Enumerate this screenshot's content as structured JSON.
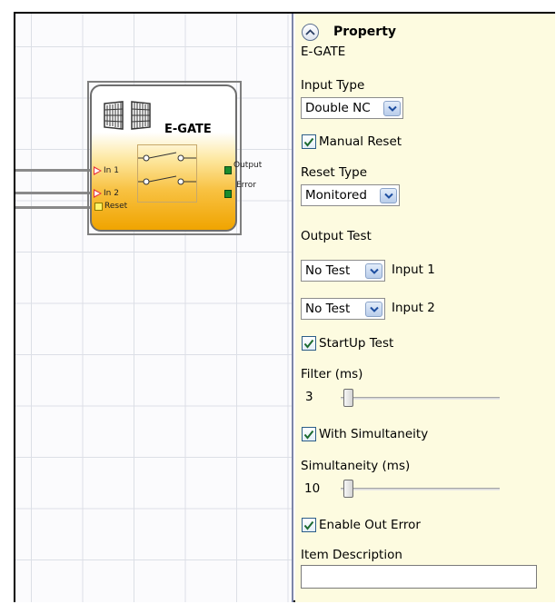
{
  "block": {
    "title": "E-GATE",
    "inputs": [
      "In 1",
      "In 2"
    ],
    "reset_pin": "Reset",
    "outputs": [
      "Output",
      "Error"
    ]
  },
  "property": {
    "header": "Property",
    "component_name": "E-GATE",
    "input_type": {
      "label": "Input Type",
      "value": "Double NC"
    },
    "manual_reset": {
      "label": "Manual Reset",
      "checked": true
    },
    "reset_type": {
      "label": "Reset Type",
      "value": "Monitored"
    },
    "output_test": {
      "label": "Output Test",
      "rows": [
        {
          "value": "No Test",
          "input": "Input 1"
        },
        {
          "value": "No Test",
          "input": "Input 2"
        }
      ]
    },
    "startup_test": {
      "label": "StartUp Test",
      "checked": true
    },
    "filter": {
      "label": "Filter (ms)",
      "value": "3"
    },
    "with_simultaneity": {
      "label": "With Simultaneity",
      "checked": true
    },
    "simultaneity": {
      "label": "Simultaneity (ms)",
      "value": "10"
    },
    "enable_out_error": {
      "label": "Enable Out Error",
      "checked": true
    },
    "item_description": {
      "label": "Item Description",
      "value": ""
    }
  },
  "icons": {
    "collapse": "chevron-up-icon",
    "dropdown": "chevron-down-icon",
    "check": "check-icon",
    "gate": "gate-icon"
  },
  "colors": {
    "panel_bg": "#fdfbe0",
    "block_gradient_end": "#f0a400",
    "input_arrow": "#e8333a",
    "output_pin": "#1a8b2c",
    "reset_pin": "#fff46a"
  }
}
